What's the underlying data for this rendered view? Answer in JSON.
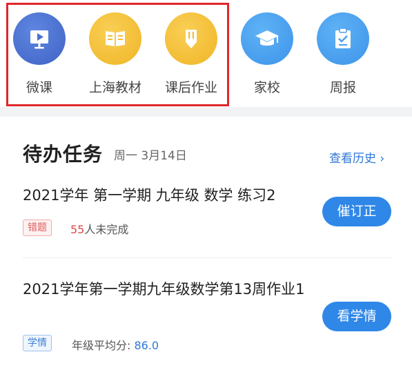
{
  "nav": {
    "items": [
      {
        "label": "微课",
        "icon": "video-lesson-icon"
      },
      {
        "label": "上海教材",
        "icon": "textbook-icon"
      },
      {
        "label": "课后作业",
        "icon": "pencil-homework-icon"
      },
      {
        "label": "家校",
        "icon": "graduation-cap-icon"
      },
      {
        "label": "周报",
        "icon": "clipboard-report-icon"
      }
    ]
  },
  "todo": {
    "title": "待办任务",
    "date": "周一 3月14日",
    "history_link": "查看历史",
    "tasks": [
      {
        "title": "2021学年 第一学期 九年级 数学 练习2",
        "tag": "错题",
        "count": "55",
        "count_suffix": "人未完成",
        "button": "催订正"
      },
      {
        "title": "2021学年第一学期九年级数学第13周作业1",
        "tag": "学情",
        "meta_label": "年级平均分: ",
        "meta_value": "86.0",
        "button": "看学情"
      }
    ]
  },
  "colors": {
    "accent": "#2f87e8",
    "highlight_border": "#e0262a",
    "warning_red": "#d94a4a"
  }
}
